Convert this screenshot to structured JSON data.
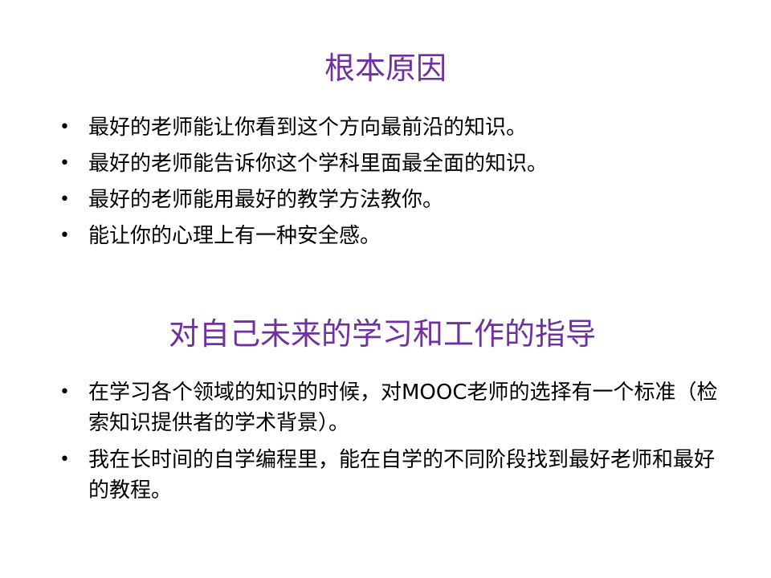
{
  "section1": {
    "title": "根本原因",
    "items": [
      "最好的老师能让你看到这个方向最前沿的知识。",
      "最好的老师能告诉你这个学科里面最全面的知识。",
      "最好的老师能用最好的教学方法教你。",
      "能让你的心理上有一种安全感。"
    ]
  },
  "section2": {
    "title": "对自己未来的学习和工作的指导",
    "items": [
      "在学习各个领域的知识的时候，对MOOC老师的选择有一个标准（检索知识提供者的学术背景）。",
      "我在长时间的自学编程里，能在自学的不同阶段找到最好老师和最好的教程。"
    ]
  },
  "bullet_symbol": "•",
  "colors": {
    "heading": "#7030a0",
    "text": "#000000",
    "background": "#ffffff"
  }
}
